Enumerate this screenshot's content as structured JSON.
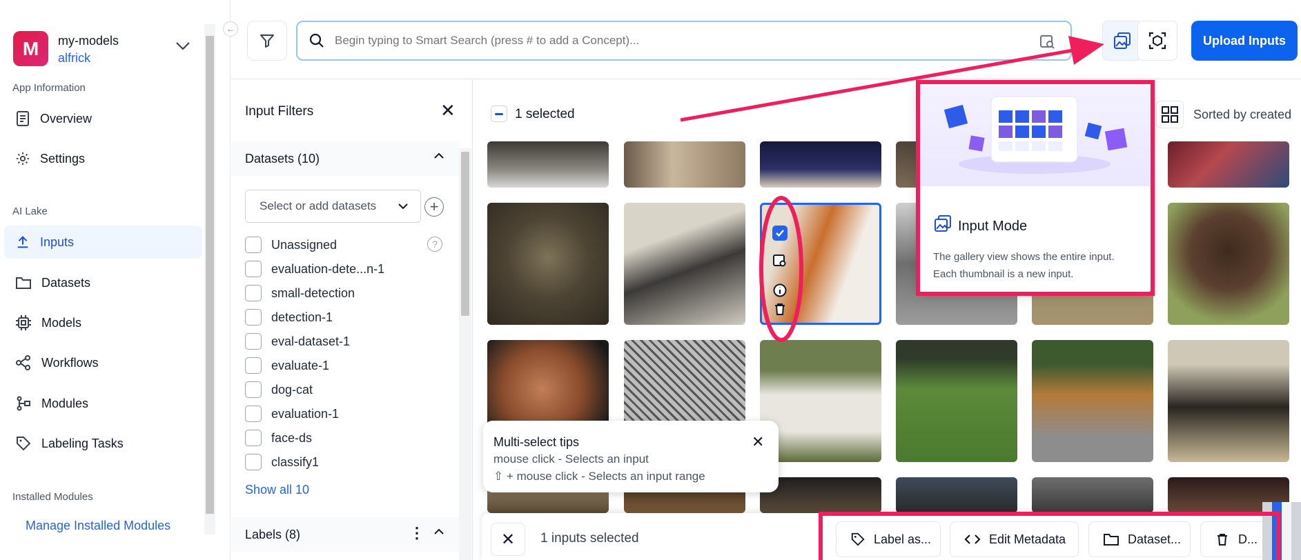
{
  "app": {
    "initial": "M",
    "name": "my-models",
    "user": "alfrick"
  },
  "sidebar": {
    "section_app_info": "App Information",
    "section_ai_lake": "AI Lake",
    "section_installed": "Installed Modules",
    "items": [
      {
        "label": "Overview",
        "icon": "document-icon"
      },
      {
        "label": "Settings",
        "icon": "gear-icon"
      },
      {
        "label": "Inputs",
        "icon": "upload-icon"
      },
      {
        "label": "Datasets",
        "icon": "folder-icon"
      },
      {
        "label": "Models",
        "icon": "chip-icon"
      },
      {
        "label": "Workflows",
        "icon": "share-icon"
      },
      {
        "label": "Modules",
        "icon": "modules-icon"
      },
      {
        "label": "Labeling Tasks",
        "icon": "tag-icon"
      }
    ],
    "manage_link": "Manage Installed Modules"
  },
  "topbar": {
    "search_placeholder": "Begin typing to Smart Search (press # to add a Concept)...",
    "upload_label": "Upload Inputs"
  },
  "filters": {
    "title": "Input Filters",
    "datasets_header": "Datasets (10)",
    "select_placeholder": "Select or add datasets",
    "datasets": [
      "Unassigned",
      "evaluation-dete...n-1",
      "small-detection",
      "detection-1",
      "eval-dataset-1",
      "evaluate-1",
      "dog-cat",
      "evaluation-1",
      "face-ds",
      "classify1"
    ],
    "show_all": "Show all 10",
    "labels_header": "Labels (8)"
  },
  "gallery": {
    "selected_text": "1 selected",
    "sorted_text": "Sorted by created"
  },
  "tips": {
    "title": "Multi-select tips",
    "line1": "mouse click - Selects an input",
    "line2": "⇧ + mouse click - Selects an input range"
  },
  "bottom_bar": {
    "count": "1 inputs selected",
    "actions": [
      "Label as...",
      "Edit Metadata",
      "Dataset...",
      "D..."
    ]
  },
  "popover": {
    "title": "Input Mode",
    "desc1": "The gallery view shows the entire input.",
    "desc2": "Each thumbnail is a new input."
  },
  "colors": {
    "accent": "#0b63ee",
    "annotation": "#ef1f5e"
  }
}
